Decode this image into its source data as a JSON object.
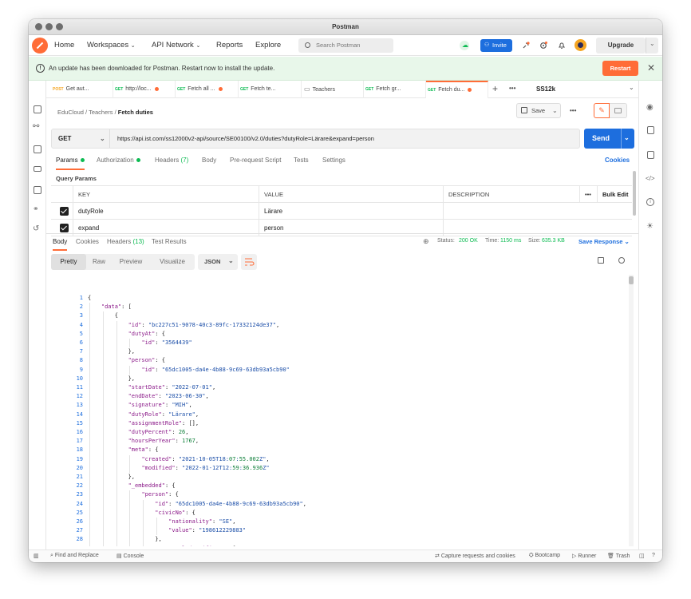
{
  "window": {
    "title": "Postman"
  },
  "header": {
    "nav": [
      "Home",
      "Workspaces",
      "API Network",
      "Reports",
      "Explore"
    ],
    "search_placeholder": "Search Postman",
    "invite_label": "Invite",
    "upgrade_label": "Upgrade"
  },
  "banner": {
    "message": "An update has been downloaded for Postman. Restart now to install the update.",
    "restart_label": "Restart"
  },
  "tabs": [
    {
      "method": "POST",
      "label": "Get aut...",
      "dot": false
    },
    {
      "method": "GET",
      "label": "http://loc...",
      "dot": true
    },
    {
      "method": "GET",
      "label": "Fetch all ...",
      "dot": true
    },
    {
      "method": "GET",
      "label": "Fetch te...",
      "dot": false
    },
    {
      "method": "",
      "label": "Teachers",
      "dot": false
    },
    {
      "method": "GET",
      "label": "Fetch gr...",
      "dot": false
    },
    {
      "method": "GET",
      "label": "Fetch du...",
      "dot": true
    }
  ],
  "environment": "SS12k",
  "breadcrumb": {
    "parts": [
      "EduCloud",
      "Teachers"
    ],
    "current": "Fetch duties"
  },
  "save_label": "Save",
  "request": {
    "method": "GET",
    "url": "https://api.ist.com/ss12000v2-api/source/SE00100/v2.0/duties?dutyRole=Lärare&expand=person",
    "send_label": "Send"
  },
  "request_tabs": {
    "params": "Params",
    "authorization": "Authorization",
    "headers": "Headers",
    "headers_count": "(7)",
    "body": "Body",
    "prerequest": "Pre-request Script",
    "tests": "Tests",
    "settings": "Settings",
    "cookies": "Cookies"
  },
  "query_params": {
    "title": "Query Params",
    "columns": [
      "KEY",
      "VALUE",
      "DESCRIPTION"
    ],
    "bulk_edit": "Bulk Edit",
    "rows": [
      {
        "key": "dutyRole",
        "value": "Lärare"
      },
      {
        "key": "expand",
        "value": "person"
      }
    ]
  },
  "response": {
    "tabs": {
      "body": "Body",
      "cookies": "Cookies",
      "headers": "Headers",
      "headers_count": "(13)",
      "test_results": "Test Results"
    },
    "status_label": "Status:",
    "status_value": "200 OK",
    "time_label": "Time:",
    "time_value": "1150 ms",
    "size_label": "Size:",
    "size_value": "635.3 KB",
    "save_response": "Save Response",
    "views": [
      "Pretty",
      "Raw",
      "Preview",
      "Visualize"
    ],
    "format": "JSON"
  },
  "code_lines": [
    "{",
    "    \"data\": [",
    "        {",
    "            \"id\": \"bc227c51-9078-40c3-89fc-17332124de37\",",
    "            \"dutyAt\": {",
    "                \"id\": \"3564439\"",
    "            },",
    "            \"person\": {",
    "                \"id\": \"65dc1005-da4e-4b88-9c69-63db93a5cb90\"",
    "            },",
    "            \"startDate\": \"2022-07-01\",",
    "            \"endDate\": \"2023-06-30\",",
    "            \"signature\": \"MIH\",",
    "            \"dutyRole\": \"Lärare\",",
    "            \"assignmentRole\": [],",
    "            \"dutyPercent\": 26,",
    "            \"hoursPerYear\": 1767,",
    "            \"meta\": {",
    "                \"created\": \"2021-10-05T18:07:55.002Z\",",
    "                \"modified\": \"2022-01-12T12:59:36.936Z\"",
    "            },",
    "            \"_embedded\": {",
    "                \"person\": {",
    "                    \"id\": \"65dc1005-da4e-4b88-9c69-63db93a5cb90\",",
    "                    \"civicNo\": {",
    "                        \"nationality\": \"SE\",",
    "                        \"value\": \"198612229883\"",
    "                    },",
    "                    \"externalIdentifiers\": [",
    "                        {"
  ],
  "footer": {
    "find_replace": "Find and Replace",
    "console": "Console",
    "capture": "Capture requests and cookies",
    "bootcamp": "Bootcamp",
    "runner": "Runner",
    "trash": "Trash"
  },
  "colors": {
    "accent": "#ff6c37",
    "primary": "#1d6ede",
    "success": "#0cbb52"
  }
}
